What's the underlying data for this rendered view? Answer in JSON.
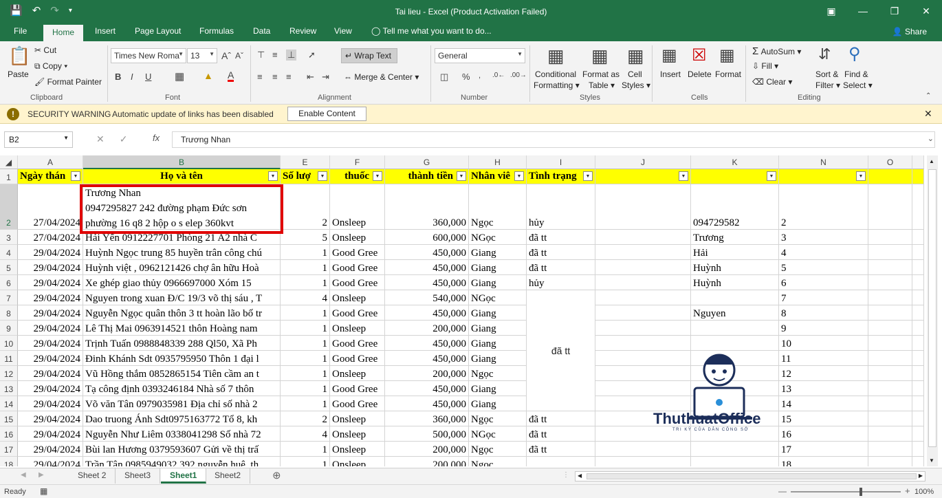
{
  "window": {
    "title": "Tai lieu - Excel (Product Activation Failed)"
  },
  "tabs": [
    "File",
    "Home",
    "Insert",
    "Page Layout",
    "Formulas",
    "Data",
    "Review",
    "View"
  ],
  "tell_me": "Tell me what you want to do...",
  "share": "Share",
  "ribbon": {
    "clipboard": {
      "paste": "Paste",
      "cut": "Cut",
      "copy": "Copy",
      "format_painter": "Format Painter",
      "label": "Clipboard"
    },
    "font": {
      "name": "Times New Roma",
      "size": "13",
      "label": "Font"
    },
    "alignment": {
      "wrap_text": "Wrap Text",
      "merge": "Merge & Center",
      "label": "Alignment"
    },
    "number": {
      "format": "General",
      "label": "Number"
    },
    "styles": {
      "conditional": "Conditional",
      "conditional2": "Formatting",
      "format_as": "Format as",
      "format_as2": "Table",
      "cell": "Cell",
      "cell2": "Styles",
      "label": "Styles"
    },
    "cells": {
      "insert": "Insert",
      "delete": "Delete",
      "format": "Format",
      "label": "Cells"
    },
    "editing": {
      "autosum": "AutoSum",
      "fill": "Fill",
      "clear": "Clear",
      "sort": "Sort &",
      "sort2": "Filter",
      "find": "Find &",
      "find2": "Select",
      "label": "Editing"
    }
  },
  "security": {
    "title": "SECURITY WARNING",
    "message": "Automatic update of links has been disabled",
    "button": "Enable Content"
  },
  "formula_bar": {
    "name_box": "B2",
    "content": "Trương Nhan"
  },
  "columns": [
    "A",
    "B",
    "E",
    "F",
    "G",
    "H",
    "I",
    "J",
    "K",
    "N",
    "O"
  ],
  "header_row": {
    "a": "Ngày thán",
    "b": "Họ và tên",
    "e": "Số lượ",
    "f": "thuốc",
    "g": "thành tiền",
    "h": "Nhân viê",
    "i": "Tình trạng"
  },
  "b2": {
    "line1": "Trương Nhan",
    "line2": "0947295827 242 đường phạm Đức sơn",
    "line3": "phường 16 q8 2 hộp o s elep 360kvt"
  },
  "rows": [
    {
      "n": "2",
      "a": "27/04/2024",
      "b": "",
      "e": "2",
      "f": "Onsleep",
      "g": "360,000",
      "h": "Ngọc",
      "i": "hủy",
      "k": "094729582"
    },
    {
      "n": "3",
      "a": "27/04/2024",
      "b": "Hải Yến 0912227701 Phòng 21 A2 nhà C",
      "e": "5",
      "f": "Onsleep",
      "g": "600,000",
      "h": "NGọc",
      "i": "đã tt",
      "k": "Trương"
    },
    {
      "n": "4",
      "a": "29/04/2024",
      "b": "Huỳnh Ngọc trung 85 huyền trân công chú",
      "e": "1",
      "f": "Good Gree",
      "g": "450,000",
      "h": "Giang",
      "i": "đã tt",
      "k": "Hải"
    },
    {
      "n": "5",
      "a": "29/04/2024",
      "b": "Huỳnh việt , 0962121426 chợ ân hữu Hoà",
      "e": "1",
      "f": "Good Gree",
      "g": "450,000",
      "h": "Giang",
      "i": "đã tt",
      "k": "Huỳnh"
    },
    {
      "n": "6",
      "a": "29/04/2024",
      "b": " Xe ghép giao thủy 0966697000 Xóm 15",
      "e": "1",
      "f": "Good Gree",
      "g": "450,000",
      "h": "Giang",
      "i": "hủy",
      "k": "Huỳnh"
    },
    {
      "n": "7",
      "a": "29/04/2024",
      "b": "Nguyen trong xuan Đ/C 19/3 võ thị sáu , T",
      "e": "4",
      "f": "Onsleep",
      "g": "540,000",
      "h": "NGọc",
      "i": "",
      "k": ""
    },
    {
      "n": "8",
      "a": "29/04/2024",
      "b": "Nguyễn Ngọc quân thôn 3 tt hoàn lão bố tr",
      "e": "1",
      "f": "Good Gree",
      "g": "450,000",
      "h": "Giang",
      "i": "",
      "k": "Nguyen"
    },
    {
      "n": "9",
      "a": "29/04/2024",
      "b": "Lê Thị Mai 0963914521 thôn Hoàng nam",
      "e": "1",
      "f": "Onsleep",
      "g": "200,000",
      "h": "Giang",
      "i": "",
      "k": ""
    },
    {
      "n": "10",
      "a": "29/04/2024",
      "b": "Trịnh Tuấn 0988848339 288 Ql50, Xã Ph",
      "e": "1",
      "f": "Good Gree",
      "g": "450,000",
      "h": "Giang",
      "i": "",
      "k": ""
    },
    {
      "n": "11",
      "a": "29/04/2024",
      "b": "Đinh Khánh Sdt 0935795950 Thôn 1 đại l",
      "e": "1",
      "f": "Good Gree",
      "g": "450,000",
      "h": "Giang",
      "i": "",
      "k": ""
    },
    {
      "n": "12",
      "a": "29/04/2024",
      "b": "Vũ Hồng thắm 0852865154 Tiên cầm an t",
      "e": "1",
      "f": "Onsleep",
      "g": "200,000",
      "h": "Ngọc",
      "i": "",
      "k": ""
    },
    {
      "n": "13",
      "a": "29/04/2024",
      "b": "Tạ công định 0393246184 Nhà số 7 thôn",
      "e": "1",
      "f": "Good Gree",
      "g": "450,000",
      "h": "Giang",
      "i": "",
      "k": ""
    },
    {
      "n": "14",
      "a": "29/04/2024",
      "b": "  Võ văn Tân 0979035981 Địa chỉ số nhà 2",
      "e": "1",
      "f": "Good Gree",
      "g": "450,000",
      "h": "Giang",
      "i": "",
      "k": ""
    },
    {
      "n": "15",
      "a": "29/04/2024",
      "b": "Dao truong Ánh  Sdt0975163772 Tổ 8, kh",
      "e": "2",
      "f": "Onsleep",
      "g": "360,000",
      "h": "Ngọc",
      "i": "đã tt",
      "k": ""
    },
    {
      "n": "16",
      "a": "29/04/2024",
      "b": "Nguyễn Như Liêm 0338041298 Số nhà 72",
      "e": "4",
      "f": "Onsleep",
      "g": "500,000",
      "h": "NGọc",
      "i": "đã tt",
      "k": ""
    },
    {
      "n": "17",
      "a": "29/04/2024",
      "b": "Bùi lan Hương 0379593607 Gửi về thị trấ",
      "e": "1",
      "f": "Onsleep",
      "g": "200,000",
      "h": "Ngọc",
      "i": "đã tt",
      "k": ""
    },
    {
      "n": "18",
      "a": "29/04/2024",
      "b": "Trần Tân 0985949032 392  nguyễn huệ, th",
      "e": "1",
      "f": "Onsleep",
      "g": "200,000",
      "h": "Ngọc",
      "i": "",
      "k": ""
    }
  ],
  "merged_i": "đã tt",
  "sheets": [
    "Sheet 2",
    "Sheet3",
    "Sheet1",
    "Sheet2"
  ],
  "active_sheet": "Sheet1",
  "status": {
    "ready": "Ready",
    "zoom": "100%"
  },
  "watermark": {
    "brand": "ThuthuatOffice",
    "tagline": "TRI KỲ CỦA DÂN CÔNG SỞ"
  }
}
